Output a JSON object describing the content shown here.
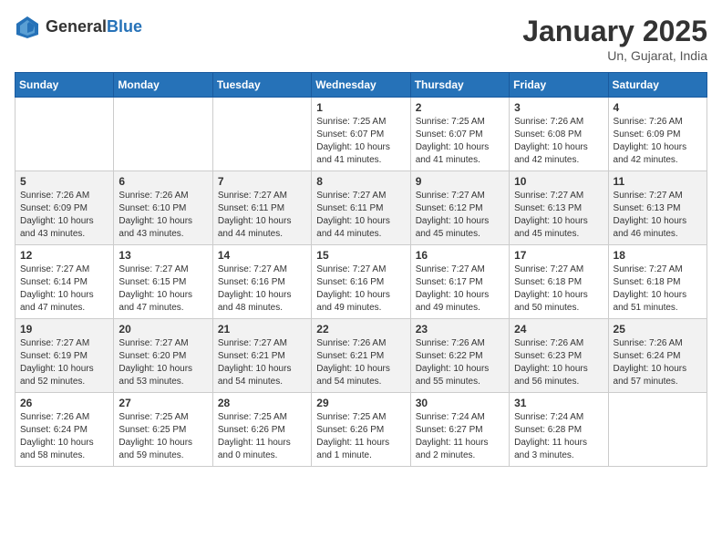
{
  "header": {
    "logo_general": "General",
    "logo_blue": "Blue",
    "month_title": "January 2025",
    "location": "Un, Gujarat, India"
  },
  "days_of_week": [
    "Sunday",
    "Monday",
    "Tuesday",
    "Wednesday",
    "Thursday",
    "Friday",
    "Saturday"
  ],
  "weeks": [
    [
      {
        "day": "",
        "info": ""
      },
      {
        "day": "",
        "info": ""
      },
      {
        "day": "",
        "info": ""
      },
      {
        "day": "1",
        "info": "Sunrise: 7:25 AM\nSunset: 6:07 PM\nDaylight: 10 hours\nand 41 minutes."
      },
      {
        "day": "2",
        "info": "Sunrise: 7:25 AM\nSunset: 6:07 PM\nDaylight: 10 hours\nand 41 minutes."
      },
      {
        "day": "3",
        "info": "Sunrise: 7:26 AM\nSunset: 6:08 PM\nDaylight: 10 hours\nand 42 minutes."
      },
      {
        "day": "4",
        "info": "Sunrise: 7:26 AM\nSunset: 6:09 PM\nDaylight: 10 hours\nand 42 minutes."
      }
    ],
    [
      {
        "day": "5",
        "info": "Sunrise: 7:26 AM\nSunset: 6:09 PM\nDaylight: 10 hours\nand 43 minutes."
      },
      {
        "day": "6",
        "info": "Sunrise: 7:26 AM\nSunset: 6:10 PM\nDaylight: 10 hours\nand 43 minutes."
      },
      {
        "day": "7",
        "info": "Sunrise: 7:27 AM\nSunset: 6:11 PM\nDaylight: 10 hours\nand 44 minutes."
      },
      {
        "day": "8",
        "info": "Sunrise: 7:27 AM\nSunset: 6:11 PM\nDaylight: 10 hours\nand 44 minutes."
      },
      {
        "day": "9",
        "info": "Sunrise: 7:27 AM\nSunset: 6:12 PM\nDaylight: 10 hours\nand 45 minutes."
      },
      {
        "day": "10",
        "info": "Sunrise: 7:27 AM\nSunset: 6:13 PM\nDaylight: 10 hours\nand 45 minutes."
      },
      {
        "day": "11",
        "info": "Sunrise: 7:27 AM\nSunset: 6:13 PM\nDaylight: 10 hours\nand 46 minutes."
      }
    ],
    [
      {
        "day": "12",
        "info": "Sunrise: 7:27 AM\nSunset: 6:14 PM\nDaylight: 10 hours\nand 47 minutes."
      },
      {
        "day": "13",
        "info": "Sunrise: 7:27 AM\nSunset: 6:15 PM\nDaylight: 10 hours\nand 47 minutes."
      },
      {
        "day": "14",
        "info": "Sunrise: 7:27 AM\nSunset: 6:16 PM\nDaylight: 10 hours\nand 48 minutes."
      },
      {
        "day": "15",
        "info": "Sunrise: 7:27 AM\nSunset: 6:16 PM\nDaylight: 10 hours\nand 49 minutes."
      },
      {
        "day": "16",
        "info": "Sunrise: 7:27 AM\nSunset: 6:17 PM\nDaylight: 10 hours\nand 49 minutes."
      },
      {
        "day": "17",
        "info": "Sunrise: 7:27 AM\nSunset: 6:18 PM\nDaylight: 10 hours\nand 50 minutes."
      },
      {
        "day": "18",
        "info": "Sunrise: 7:27 AM\nSunset: 6:18 PM\nDaylight: 10 hours\nand 51 minutes."
      }
    ],
    [
      {
        "day": "19",
        "info": "Sunrise: 7:27 AM\nSunset: 6:19 PM\nDaylight: 10 hours\nand 52 minutes."
      },
      {
        "day": "20",
        "info": "Sunrise: 7:27 AM\nSunset: 6:20 PM\nDaylight: 10 hours\nand 53 minutes."
      },
      {
        "day": "21",
        "info": "Sunrise: 7:27 AM\nSunset: 6:21 PM\nDaylight: 10 hours\nand 54 minutes."
      },
      {
        "day": "22",
        "info": "Sunrise: 7:26 AM\nSunset: 6:21 PM\nDaylight: 10 hours\nand 54 minutes."
      },
      {
        "day": "23",
        "info": "Sunrise: 7:26 AM\nSunset: 6:22 PM\nDaylight: 10 hours\nand 55 minutes."
      },
      {
        "day": "24",
        "info": "Sunrise: 7:26 AM\nSunset: 6:23 PM\nDaylight: 10 hours\nand 56 minutes."
      },
      {
        "day": "25",
        "info": "Sunrise: 7:26 AM\nSunset: 6:24 PM\nDaylight: 10 hours\nand 57 minutes."
      }
    ],
    [
      {
        "day": "26",
        "info": "Sunrise: 7:26 AM\nSunset: 6:24 PM\nDaylight: 10 hours\nand 58 minutes."
      },
      {
        "day": "27",
        "info": "Sunrise: 7:25 AM\nSunset: 6:25 PM\nDaylight: 10 hours\nand 59 minutes."
      },
      {
        "day": "28",
        "info": "Sunrise: 7:25 AM\nSunset: 6:26 PM\nDaylight: 11 hours\nand 0 minutes."
      },
      {
        "day": "29",
        "info": "Sunrise: 7:25 AM\nSunset: 6:26 PM\nDaylight: 11 hours\nand 1 minute."
      },
      {
        "day": "30",
        "info": "Sunrise: 7:24 AM\nSunset: 6:27 PM\nDaylight: 11 hours\nand 2 minutes."
      },
      {
        "day": "31",
        "info": "Sunrise: 7:24 AM\nSunset: 6:28 PM\nDaylight: 11 hours\nand 3 minutes."
      },
      {
        "day": "",
        "info": ""
      }
    ]
  ]
}
